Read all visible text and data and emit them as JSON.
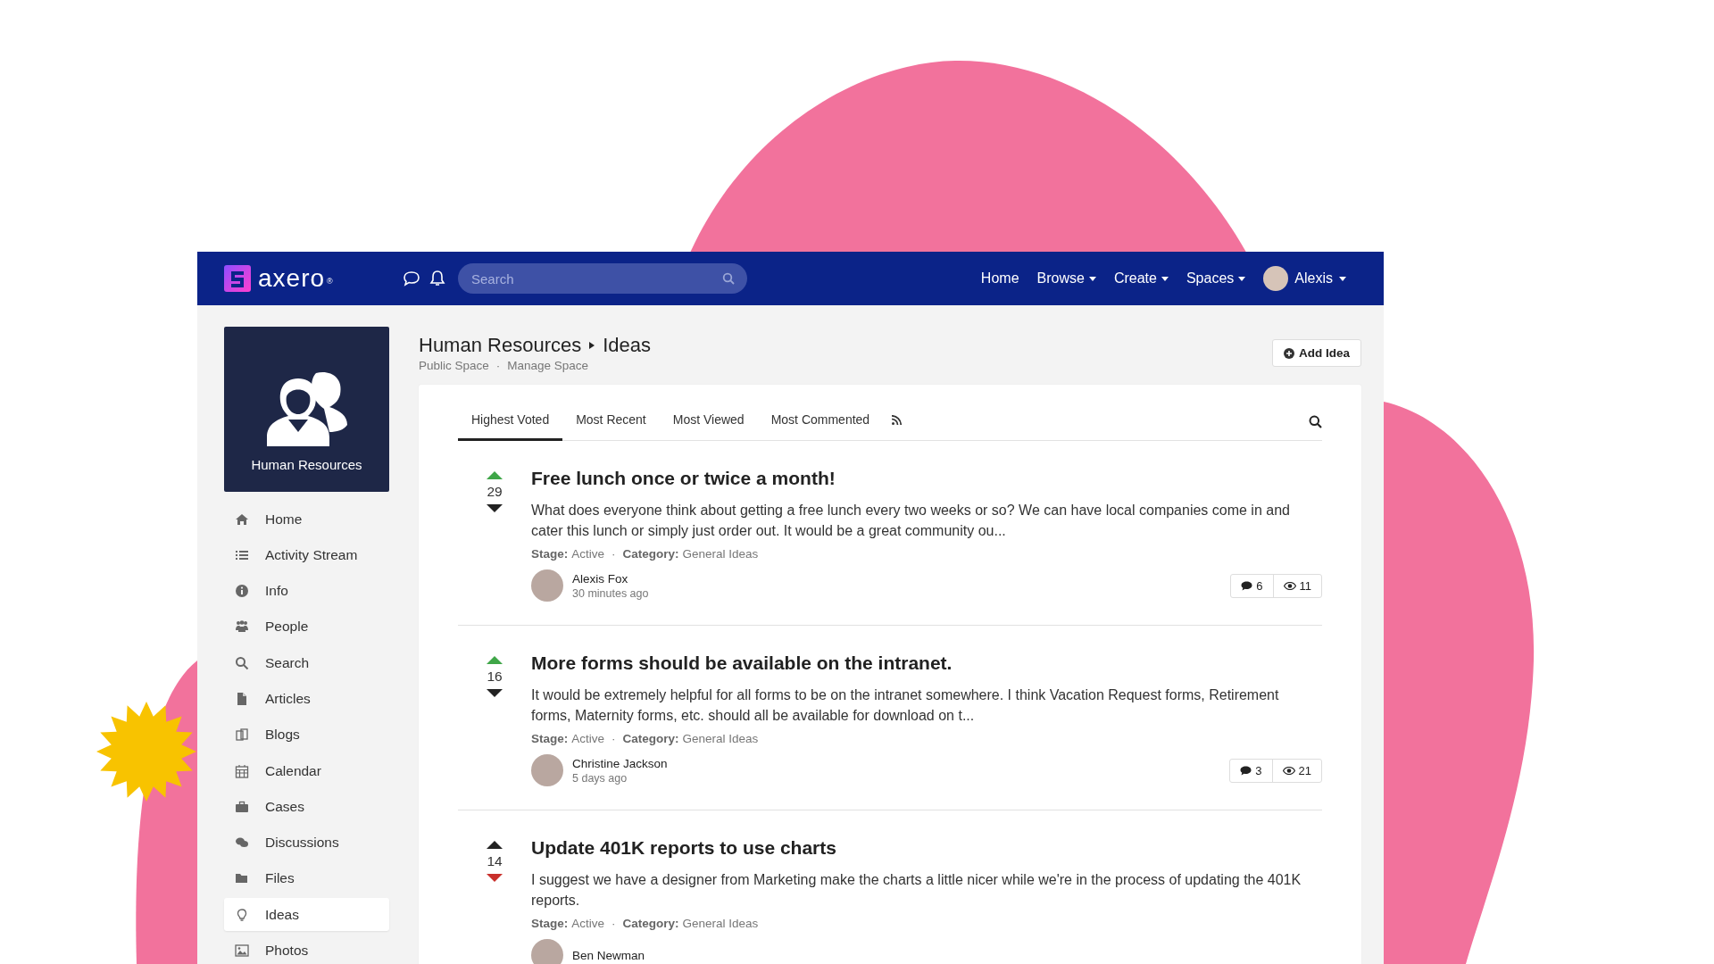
{
  "brand": {
    "name": "axero",
    "mark": "®"
  },
  "nav": {
    "search": {
      "placeholder": "Search"
    },
    "links": [
      {
        "label": "Home",
        "dropdown": false
      },
      {
        "label": "Browse",
        "dropdown": true
      },
      {
        "label": "Create",
        "dropdown": true
      },
      {
        "label": "Spaces",
        "dropdown": true
      }
    ],
    "user": {
      "name": "Alexis",
      "dropdown": true
    }
  },
  "space": {
    "name": "Human Resources"
  },
  "sidebar": {
    "items": [
      {
        "label": "Home",
        "kind": "home",
        "selected": false
      },
      {
        "label": "Activity Stream",
        "kind": "list",
        "selected": false
      },
      {
        "label": "Info",
        "kind": "info",
        "selected": false
      },
      {
        "label": "People",
        "kind": "people",
        "selected": false
      },
      {
        "label": "Search",
        "kind": "search",
        "selected": false
      },
      {
        "label": "Articles",
        "kind": "file",
        "selected": false
      },
      {
        "label": "Blogs",
        "kind": "blogs",
        "selected": false
      },
      {
        "label": "Calendar",
        "kind": "calendar",
        "selected": false
      },
      {
        "label": "Cases",
        "kind": "briefcase",
        "selected": false
      },
      {
        "label": "Discussions",
        "kind": "chat",
        "selected": false
      },
      {
        "label": "Files",
        "kind": "folder",
        "selected": false
      },
      {
        "label": "Ideas",
        "kind": "bulb",
        "selected": true
      },
      {
        "label": "Photos",
        "kind": "image",
        "selected": false
      }
    ]
  },
  "header": {
    "space": "Human Resources",
    "page": "Ideas",
    "links": [
      "Public Space",
      "Manage Space"
    ],
    "separator": "·",
    "add_button": "Add Idea"
  },
  "tabs": [
    {
      "label": "Highest Voted",
      "selected": true
    },
    {
      "label": "Most Recent",
      "selected": false
    },
    {
      "label": "Most Viewed",
      "selected": false
    },
    {
      "label": "Most Commented",
      "selected": false
    }
  ],
  "ideas": [
    {
      "votes": "29",
      "upvoted": true,
      "downvoted": false,
      "title": "Free lunch once or twice a month!",
      "excerpt": "What does everyone think about getting a free lunch every two weeks or so? We can have local companies come in and cater this lunch or simply just order out. It would be a great community ou...",
      "stage_label": "Stage:",
      "stage": "Active",
      "separator": "·",
      "category_label": "Category:",
      "category": "General Ideas",
      "author": "Alexis Fox",
      "time": "30 minutes ago",
      "comments": "6",
      "views": "11"
    },
    {
      "votes": "16",
      "upvoted": true,
      "downvoted": false,
      "title": "More forms should be available on the intranet.",
      "excerpt": "It would be extremely helpful for all forms to be on the intranet somewhere. I think Vacation Request forms, Retirement forms, Maternity forms, etc. should all be available for download on t...",
      "stage_label": "Stage:",
      "stage": "Active",
      "separator": "·",
      "category_label": "Category:",
      "category": "General Ideas",
      "author": "Christine Jackson",
      "time": "5 days ago",
      "comments": "3",
      "views": "21"
    },
    {
      "votes": "14",
      "upvoted": false,
      "downvoted": true,
      "title": "Update 401K reports to use charts",
      "excerpt": "I suggest we have a designer from Marketing make the charts a little nicer while we're in the process of updating the 401K reports.",
      "stage_label": "Stage:",
      "stage": "Active",
      "separator": "·",
      "category_label": "Category:",
      "category": "General Ideas",
      "author": "Ben Newman"
    }
  ]
}
